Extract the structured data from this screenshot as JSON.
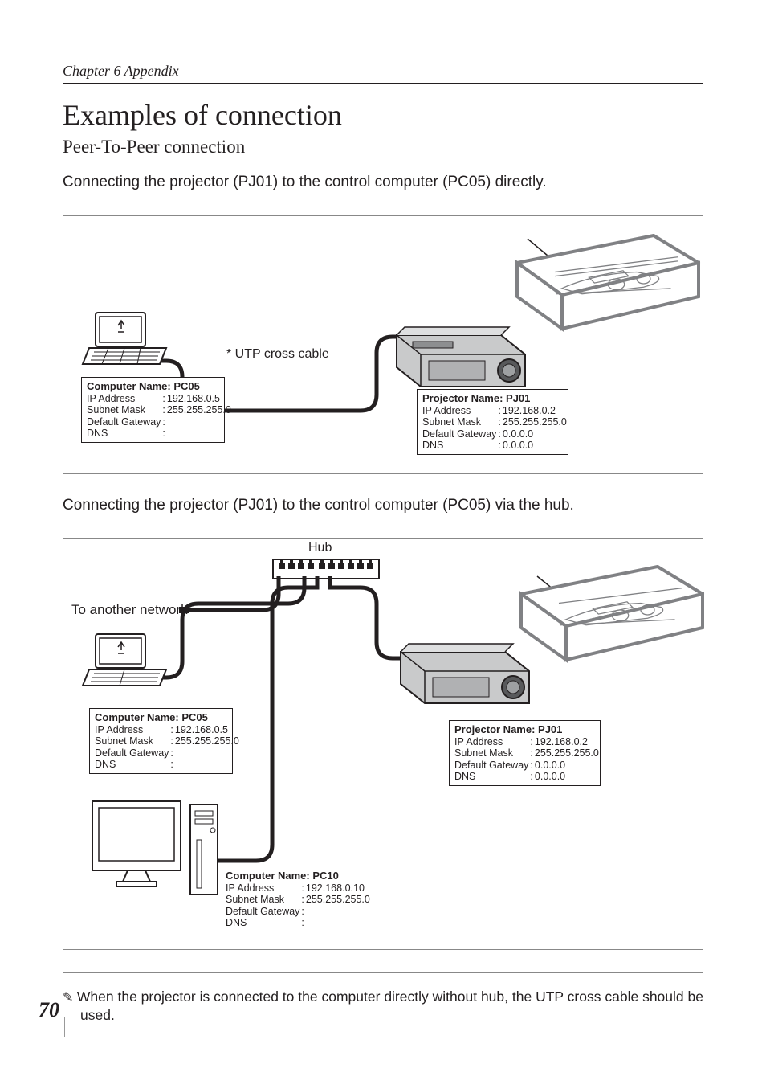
{
  "chapter": "Chapter 6 Appendix",
  "title": "Examples of connection",
  "subtitle": "Peer-To-Peer connection",
  "intro1": "Connecting the projector (PJ01) to the control computer (PC05) directly.",
  "intro2": "Connecting the projector (PJ01) to the control computer (PC05) via the hub.",
  "cable_label": "* UTP cross cable",
  "hub_label": "Hub",
  "to_network_label": "To another network",
  "pc05": {
    "title": "Computer Name: PC05",
    "ip_label": "IP Address",
    "ip": "192.168.0.5",
    "mask_label": "Subnet Mask",
    "mask": "255.255.255.0",
    "gw_label": "Default Gateway",
    "gw": "",
    "dns_label": "DNS",
    "dns": ""
  },
  "pj01": {
    "title": "Projector Name: PJ01",
    "ip_label": "IP Address",
    "ip": "192.168.0.2",
    "mask_label": "Subnet Mask",
    "mask": "255.255.255.0",
    "gw_label": "Default Gateway",
    "gw": "0.0.0.0",
    "dns_label": "DNS",
    "dns": "0.0.0.0"
  },
  "pc10": {
    "title": "Computer Name: PC10",
    "ip_label": "IP Address",
    "ip": "192.168.0.10",
    "mask_label": "Subnet Mask",
    "mask": "255.255.255.0",
    "gw_label": "Default Gateway",
    "gw": "",
    "dns_label": "DNS",
    "dns": ""
  },
  "footnote": "When the projector is connected to the computer directly without hub, the UTP cross cable should be used.",
  "page_number": "70"
}
